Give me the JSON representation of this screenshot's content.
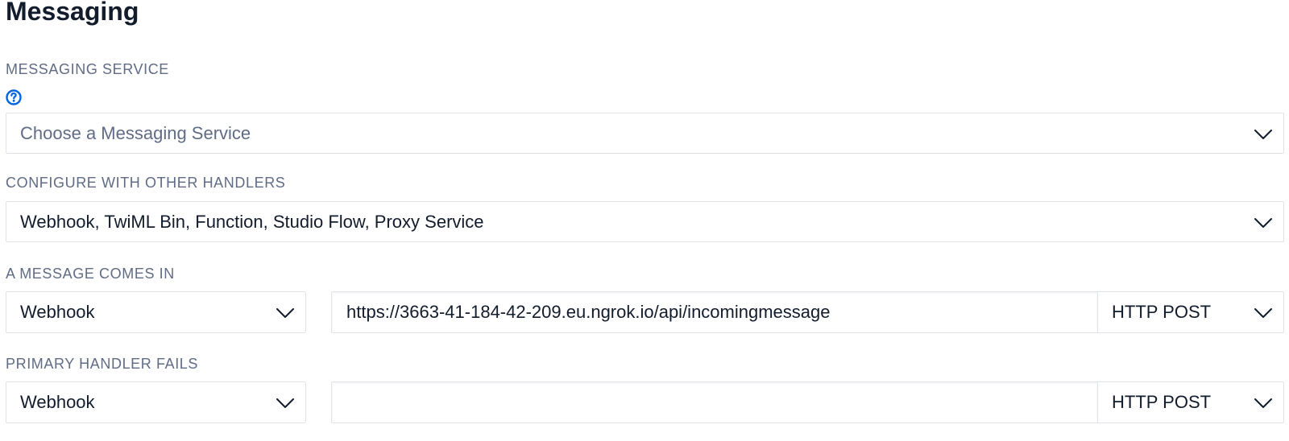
{
  "page_title": "Messaging",
  "messaging_service": {
    "label": "MESSAGING SERVICE",
    "help_icon": "question-circle-icon",
    "placeholder": "Choose a Messaging Service"
  },
  "other_handlers": {
    "label": "CONFIGURE WITH OTHER HANDLERS",
    "value": "Webhook, TwiML Bin, Function, Studio Flow, Proxy Service"
  },
  "message_comes_in": {
    "label": "A MESSAGE COMES IN",
    "handler_type": "Webhook",
    "url": "https://3663-41-184-42-209.eu.ngrok.io/api/incomingmessage",
    "method": "HTTP POST"
  },
  "primary_handler_fails": {
    "label": "PRIMARY HANDLER FAILS",
    "handler_type": "Webhook",
    "url": "",
    "method": "HTTP POST"
  },
  "colors": {
    "text": "#121c2d",
    "label": "#606b85",
    "border": "#e1e3ea",
    "help_icon": "#0263e0"
  }
}
